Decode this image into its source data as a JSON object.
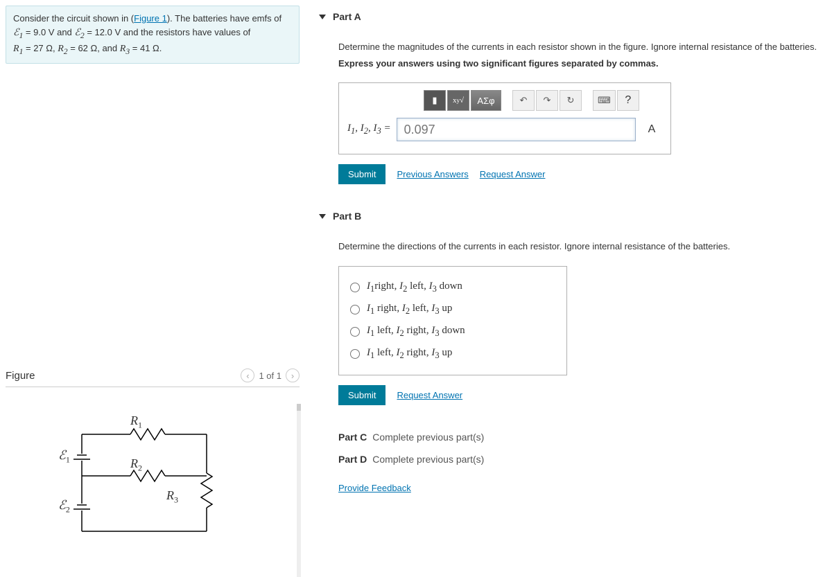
{
  "problem": {
    "text_part1": "Consider the circuit shown in (",
    "figure_link": "Figure 1",
    "text_part2": "). The batteries have emfs of",
    "line2_a": "ℰ",
    "line2_a_sub": "1",
    "line2_b": " = 9.0 V and ",
    "line2_c": "ℰ",
    "line2_c_sub": "2",
    "line2_d": " = 12.0 V and the resistors have values of",
    "line3_a": "R",
    "line3_a_sub": "1",
    "line3_b": " = 27 Ω, ",
    "line3_c": "R",
    "line3_c_sub": "2",
    "line3_d": " = 62 Ω, and ",
    "line3_e": "R",
    "line3_e_sub": "3",
    "line3_f": " = 41 Ω."
  },
  "figure": {
    "title": "Figure",
    "pager": "1 of 1",
    "labels": {
      "R1": "R",
      "R1s": "1",
      "R2": "R",
      "R2s": "2",
      "R3": "R",
      "R3s": "3",
      "E1": "ℰ",
      "E1s": "1",
      "E2": "ℰ",
      "E2s": "2"
    }
  },
  "partA": {
    "title": "Part A",
    "instr1": "Determine the magnitudes of the currents in each resistor shown in the figure. Ignore internal resistance of the batteries.",
    "instr2": "Express your answers using two significant figures separated by commas.",
    "toolbar": {
      "menu": "▮",
      "tmpl": "√x",
      "greek": "ΑΣφ",
      "undo": "↶",
      "redo": "↷",
      "reset": "↻",
      "kbd": "⌨",
      "help": "?"
    },
    "input_label_a": "I",
    "input_label_a1": "1",
    "input_label_sep": ", ",
    "input_label_b": "I",
    "input_label_b1": "2",
    "input_label_c": "I",
    "input_label_c1": "3",
    "input_label_eq": " = ",
    "input_value": "0.097",
    "unit": "A",
    "submit": "Submit",
    "prev_answers": "Previous Answers",
    "request_answer": "Request Answer"
  },
  "partB": {
    "title": "Part B",
    "instr": "Determine the directions of the currents in each resistor. Ignore internal resistance of the batteries.",
    "choices": [
      {
        "i1": "I",
        "i1s": "1",
        "d1": "right, ",
        "i2": "I",
        "i2s": "2",
        "d2": " left, ",
        "i3": "I",
        "i3s": "3",
        "d3": " down"
      },
      {
        "i1": "I",
        "i1s": "1",
        "d1": " right, ",
        "i2": "I",
        "i2s": "2",
        "d2": " left, ",
        "i3": "I",
        "i3s": "3",
        "d3": " up"
      },
      {
        "i1": "I",
        "i1s": "1",
        "d1": " left, ",
        "i2": "I",
        "i2s": "2",
        "d2": " right, ",
        "i3": "I",
        "i3s": "3",
        "d3": " down"
      },
      {
        "i1": "I",
        "i1s": "1",
        "d1": " left, ",
        "i2": "I",
        "i2s": "2",
        "d2": " right, ",
        "i3": "I",
        "i3s": "3",
        "d3": " up"
      }
    ],
    "submit": "Submit",
    "request_answer": "Request Answer"
  },
  "partC": {
    "label": "Part C",
    "msg": "Complete previous part(s)"
  },
  "partD": {
    "label": "Part D",
    "msg": "Complete previous part(s)"
  },
  "feedback": "Provide Feedback"
}
